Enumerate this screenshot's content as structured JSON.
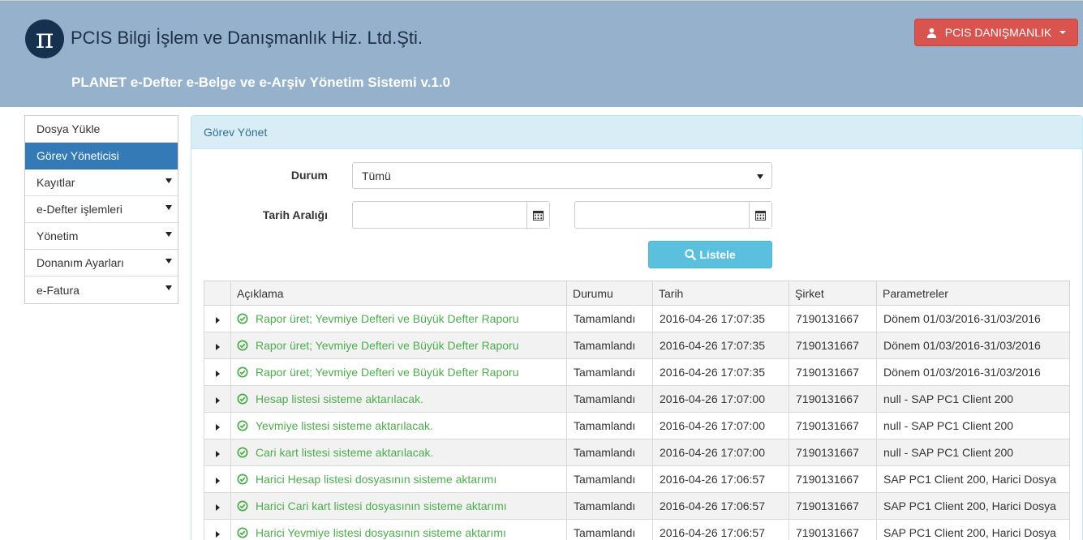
{
  "header": {
    "logo_glyph": "π",
    "company": "PCIS Bilgi İşlem ve Danışmanlık Hiz. Ltd.Şti.",
    "system_name": "PLANET e-Defter e-Belge ve e-Arşiv Yönetim Sistemi v.1.0",
    "user_label": "PCIS DANIŞMANLIK",
    "user_icon": "user-icon",
    "colors": {
      "header_bg": "#95b1cc",
      "user_btn": "#d9534f"
    }
  },
  "sidebar": {
    "items": [
      {
        "label": "Dosya Yükle",
        "active": false,
        "dropdown": false
      },
      {
        "label": "Görev Yöneticisi",
        "active": true,
        "dropdown": false
      },
      {
        "label": "Kayıtlar",
        "active": false,
        "dropdown": true
      },
      {
        "label": "e-Defter işlemleri",
        "active": false,
        "dropdown": true
      },
      {
        "label": "Yönetim",
        "active": false,
        "dropdown": true
      },
      {
        "label": "Donanım Ayarları",
        "active": false,
        "dropdown": true
      },
      {
        "label": "e-Fatura",
        "active": false,
        "dropdown": true
      }
    ],
    "active_color": "#337ab7"
  },
  "panel": {
    "title": "Görev Yönet",
    "filters": {
      "status_label": "Durum",
      "status_value": "Tümü",
      "date_range_label": "Tarih Aralığı",
      "date_from": "",
      "date_to": "",
      "calendar_icon": "calendar-icon"
    },
    "list_button": "Listele",
    "list_button_icon": "search-icon"
  },
  "table": {
    "columns": [
      "",
      "Açıklama",
      "Durumu",
      "Tarih",
      "Şirket",
      "Parametreler"
    ],
    "status_icon": "check-circle-icon",
    "success_color": "#4cae4c",
    "rows": [
      {
        "description": "Rapor üret; Yevmiye Defteri ve Büyük Defter Raporu",
        "status": "Tamamlandı",
        "date": "2016-04-26 17:07:35",
        "company": "7190131667",
        "params": "Dönem 01/03/2016-31/03/2016"
      },
      {
        "description": "Rapor üret; Yevmiye Defteri ve Büyük Defter Raporu",
        "status": "Tamamlandı",
        "date": "2016-04-26 17:07:35",
        "company": "7190131667",
        "params": "Dönem 01/03/2016-31/03/2016"
      },
      {
        "description": "Rapor üret; Yevmiye Defteri ve Büyük Defter Raporu",
        "status": "Tamamlandı",
        "date": "2016-04-26 17:07:35",
        "company": "7190131667",
        "params": "Dönem 01/03/2016-31/03/2016"
      },
      {
        "description": "Hesap listesi sisteme aktarılacak.",
        "status": "Tamamlandı",
        "date": "2016-04-26 17:07:00",
        "company": "7190131667",
        "params": "null - SAP PC1 Client 200"
      },
      {
        "description": "Yevmiye listesi sisteme aktarılacak.",
        "status": "Tamamlandı",
        "date": "2016-04-26 17:07:00",
        "company": "7190131667",
        "params": "null - SAP PC1 Client 200"
      },
      {
        "description": "Cari kart listesi sisteme aktarılacak.",
        "status": "Tamamlandı",
        "date": "2016-04-26 17:07:00",
        "company": "7190131667",
        "params": "null - SAP PC1 Client 200"
      },
      {
        "description": "Harici Hesap listesi dosyasının sisteme aktarımı",
        "status": "Tamamlandı",
        "date": "2016-04-26 17:06:57",
        "company": "7190131667",
        "params": "SAP PC1 Client 200, Harici Dosya"
      },
      {
        "description": "Harici Cari kart listesi dosyasının sisteme aktarımı",
        "status": "Tamamlandı",
        "date": "2016-04-26 17:06:57",
        "company": "7190131667",
        "params": "SAP PC1 Client 200, Harici Dosya"
      },
      {
        "description": "Harici Yevmiye listesi dosyasının sisteme aktarımı",
        "status": "Tamamlandı",
        "date": "2016-04-26 17:06:57",
        "company": "7190131667",
        "params": "SAP PC1 Client 200, Harici Dosya"
      }
    ]
  }
}
